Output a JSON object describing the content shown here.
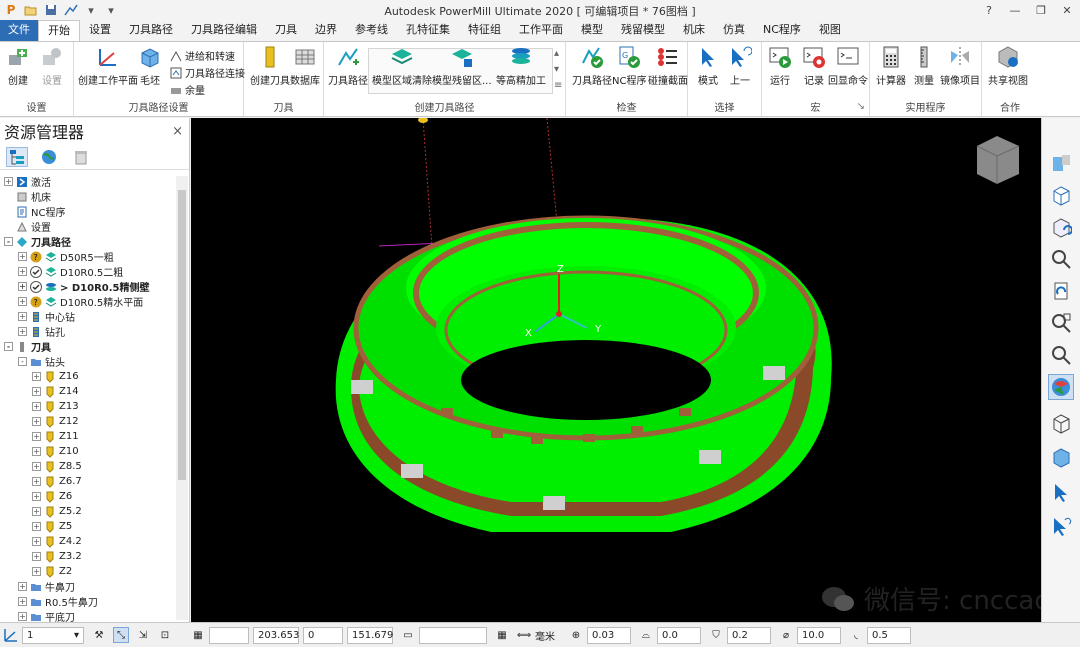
{
  "window": {
    "title": "Autodesk PowerMill Ultimate 2020  [ 可编辑项目 * 76图档 ]",
    "help": "?",
    "minimize": "—",
    "restore": "❐",
    "close": "✕"
  },
  "tabs": [
    "文件",
    "开始",
    "设置",
    "刀具路径",
    "刀具路径编辑",
    "刀具",
    "边界",
    "参考线",
    "孔特征集",
    "特征组",
    "工作平面",
    "模型",
    "残留模型",
    "机床",
    "仿真",
    "NC程序",
    "视图"
  ],
  "ribbon": {
    "groups": {
      "setup": "设置",
      "toolpath_setup": "刀具路径设置",
      "tool": "刀具",
      "create_toolpath": "创建刀具路径",
      "check": "检查",
      "select": "选择",
      "macro": "宏",
      "utilities": "实用程序",
      "collab": "合作"
    },
    "buttons": {
      "create": "创建",
      "settings": "设置",
      "create_workplane": "创建工作平面",
      "block": "毛坯",
      "feeds": "进给和转速",
      "connections": "刀具路径连接",
      "thickness": "余量",
      "create_tool": "创建刀具",
      "database": "数据库",
      "toolpath": "刀具路径",
      "model_area_clear": "模型区域清除",
      "model_rest": "模型残留区...",
      "constant_z": "等高精加工",
      "check_toolpath": "刀具路径",
      "check_nc": "NC程序",
      "collision": "碰撞截面",
      "mode": "模式",
      "previous": "上一",
      "run": "运行",
      "record": "记录",
      "echo": "回显命令",
      "calculator": "计算器",
      "measure": "测量",
      "mirror": "镜像项目",
      "share_view": "共享视图"
    }
  },
  "explorer": {
    "title": "资源管理器",
    "close": "×",
    "tree": [
      {
        "label": "激活",
        "level": 0,
        "exp": "+",
        "icon": "active-icon",
        "color": "#1a6fc0"
      },
      {
        "label": "机床",
        "level": 0,
        "exp": "",
        "icon": "machine-icon",
        "color": "#777"
      },
      {
        "label": "NC程序",
        "level": 0,
        "exp": "",
        "icon": "nc-program-icon",
        "color": "#2d6db5"
      },
      {
        "label": "设置",
        "level": 0,
        "exp": "",
        "icon": "setup-icon",
        "color": "#777"
      },
      {
        "label": "刀具路径",
        "level": 0,
        "exp": "-",
        "icon": "toolpaths-folder-icon",
        "color": "#2aa8c8",
        "bold": true
      },
      {
        "label": "D50R5一粗",
        "level": 1,
        "exp": "+",
        "icon": "toolpath-question-icon",
        "color": "#d4a017"
      },
      {
        "label": "D10R0.5二粗",
        "level": 1,
        "exp": "+",
        "icon": "toolpath-check-icon",
        "color": "#1ca38a"
      },
      {
        "label": "> D10R0.5精侧壁",
        "level": 1,
        "exp": "+",
        "icon": "toolpath-active-icon",
        "color": "#1ca38a",
        "bold": true
      },
      {
        "label": "D10R0.5精水平面",
        "level": 1,
        "exp": "+",
        "icon": "toolpath-question-icon",
        "color": "#d4a017"
      },
      {
        "label": "中心钻",
        "level": 1,
        "exp": "+",
        "icon": "drilling-icon",
        "color": "#2d6db5"
      },
      {
        "label": "钻孔",
        "level": 1,
        "exp": "+",
        "icon": "drilling-icon",
        "color": "#2d6db5"
      },
      {
        "label": "刀具",
        "level": 0,
        "exp": "-",
        "icon": "tools-folder-icon",
        "color": "#888",
        "bold": true
      },
      {
        "label": "钻头",
        "level": 1,
        "exp": "-",
        "icon": "folder-icon",
        "color": "#5b8fd4"
      },
      {
        "label": "Z16",
        "level": 2,
        "exp": "+",
        "icon": "drill-tool-icon",
        "color": "#e8c020"
      },
      {
        "label": "Z14",
        "level": 2,
        "exp": "+",
        "icon": "drill-tool-icon",
        "color": "#e8c020"
      },
      {
        "label": "Z13",
        "level": 2,
        "exp": "+",
        "icon": "drill-tool-icon",
        "color": "#e8c020"
      },
      {
        "label": "Z12",
        "level": 2,
        "exp": "+",
        "icon": "drill-tool-icon",
        "color": "#e8c020"
      },
      {
        "label": "Z11",
        "level": 2,
        "exp": "+",
        "icon": "drill-tool-icon",
        "color": "#e8c020"
      },
      {
        "label": "Z10",
        "level": 2,
        "exp": "+",
        "icon": "drill-tool-icon",
        "color": "#e8c020"
      },
      {
        "label": "Z8.5",
        "level": 2,
        "exp": "+",
        "icon": "drill-tool-icon",
        "color": "#e8c020"
      },
      {
        "label": "Z6.7",
        "level": 2,
        "exp": "+",
        "icon": "drill-tool-icon",
        "color": "#e8c020"
      },
      {
        "label": "Z6",
        "level": 2,
        "exp": "+",
        "icon": "drill-tool-icon",
        "color": "#e8c020"
      },
      {
        "label": "Z5.2",
        "level": 2,
        "exp": "+",
        "icon": "drill-tool-icon",
        "color": "#e8c020"
      },
      {
        "label": "Z5",
        "level": 2,
        "exp": "+",
        "icon": "drill-tool-icon",
        "color": "#e8c020"
      },
      {
        "label": "Z4.2",
        "level": 2,
        "exp": "+",
        "icon": "drill-tool-icon",
        "color": "#e8c020"
      },
      {
        "label": "Z3.2",
        "level": 2,
        "exp": "+",
        "icon": "drill-tool-icon",
        "color": "#e8c020"
      },
      {
        "label": "Z2",
        "level": 2,
        "exp": "+",
        "icon": "drill-tool-icon",
        "color": "#e8c020"
      },
      {
        "label": "牛鼻刀",
        "level": 1,
        "exp": "+",
        "icon": "folder-icon",
        "color": "#5b8fd4"
      },
      {
        "label": "R0.5牛鼻刀",
        "level": 1,
        "exp": "+",
        "icon": "folder-icon",
        "color": "#5b8fd4"
      },
      {
        "label": "平底刀",
        "level": 1,
        "exp": "+",
        "icon": "folder-icon",
        "color": "#5b8fd4"
      }
    ]
  },
  "viewport": {
    "axis_x": "X",
    "axis_y": "Y",
    "axis_z": "Z",
    "watermark": "微信号: cnccad",
    "colors": {
      "background": "#000000",
      "toolpath": "#00ff00",
      "model": "#a0603a"
    }
  },
  "status": {
    "workplane": "1",
    "coord_x": "203.653",
    "coord_y": "0",
    "coord_z": "151.679",
    "units": "毫米",
    "tolerance": "0.03",
    "thickness": "0.0",
    "tool_dia": "0.2",
    "dia": "10.0",
    "corner": "0.5"
  }
}
